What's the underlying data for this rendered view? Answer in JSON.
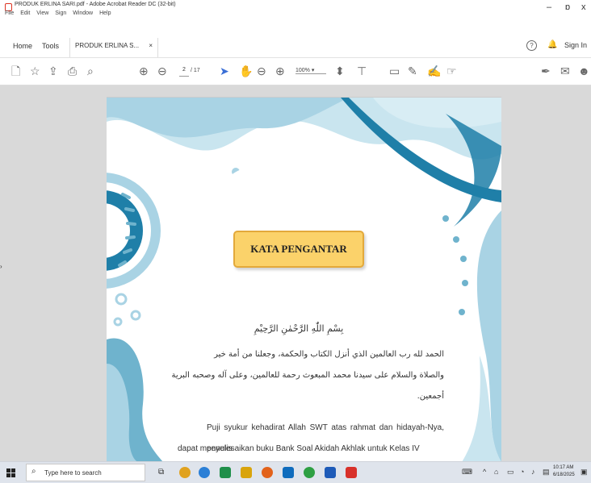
{
  "window": {
    "title": "PRODUK ERLINA SARI.pdf - Adobe Acrobat Reader DC (32-bit)",
    "menu": [
      "File",
      "Edit",
      "View",
      "Sign",
      "Window",
      "Help"
    ],
    "minimize": "–",
    "restore": "ɒ",
    "close": "x"
  },
  "tabs": {
    "home": "Home",
    "tools": "Tools",
    "document": "PRODUK ERLINA S...",
    "close": "×",
    "help": "?",
    "signin": "Sign In"
  },
  "toolbar": {
    "page_current": "2",
    "page_total": "/ 17",
    "zoom": "100%"
  },
  "document": {
    "heading": "KATA PENGANTAR",
    "basmala": "بِسْمِ اللّٰهِ الرَّحْمٰنِ الرَّحِيْمِ",
    "arabic_lines": [
      "الحمد لله رب العالمين الذي أنزل الكتاب والحكمة، وجعلنا من أمة خير",
      "والصلاة والسلام على سيدنا محمد المبعوث رحمة للعالمين، وعلى آله وصحبه  البرية",
      "أجمعين."
    ],
    "para_lines": [
      "Puji syukur kehadirat Allah SWT atas rahmat dan hidayah-Nya, penulis",
      "dapat menyelesaikan buku Bank Soal Akidah Akhlak untuk Kelas IV"
    ]
  },
  "taskbar": {
    "search_placeholder": "Type here to search",
    "time": "10:17 AM",
    "date": "6/18/2025"
  },
  "colors": {
    "accent_dark": "#1f7fa8",
    "accent_light": "#a9d3e4",
    "heading_fill": "#fbd26a"
  }
}
